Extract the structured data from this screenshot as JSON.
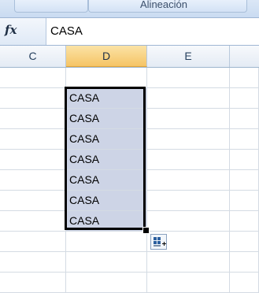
{
  "ribbon": {
    "group_label": "Alineación",
    "arrow": "▾"
  },
  "formula_bar": {
    "fx_label": "fx",
    "value": "CASA"
  },
  "columns": [
    "C",
    "D",
    "E"
  ],
  "selected_column": "D",
  "cells": {
    "D": [
      "",
      "CASA",
      "CASA",
      "CASA",
      "CASA",
      "CASA",
      "CASA",
      "CASA",
      "",
      "",
      ""
    ]
  },
  "icons": {
    "autofill_options": "autofill-options-icon",
    "fill_handle": "fill-handle"
  },
  "colors": {
    "selection_fill": "#cdd4e6",
    "header_selected": "#f5c465",
    "grid_line": "#d4dbe3"
  }
}
